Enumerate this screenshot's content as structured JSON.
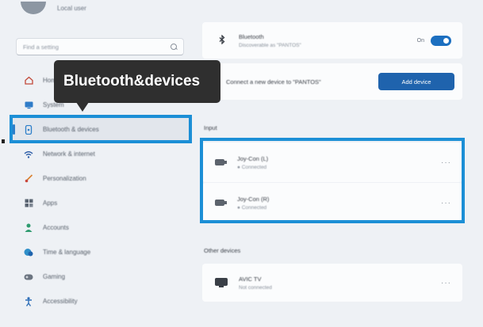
{
  "user": {
    "name": "Local user"
  },
  "search": {
    "placeholder": "Find a setting"
  },
  "sidebar": {
    "items": [
      {
        "label": "Home",
        "icon": "home-icon"
      },
      {
        "label": "System",
        "icon": "monitor-icon"
      },
      {
        "label": "Bluetooth & devices",
        "icon": "bluetooth-devices-icon",
        "selected": true
      },
      {
        "label": "Network & internet",
        "icon": "wifi-icon"
      },
      {
        "label": "Personalization",
        "icon": "brush-icon"
      },
      {
        "label": "Apps",
        "icon": "apps-icon"
      },
      {
        "label": "Accounts",
        "icon": "person-icon"
      },
      {
        "label": "Time & language",
        "icon": "globe-clock-icon"
      },
      {
        "label": "Gaming",
        "icon": "gamepad-icon"
      },
      {
        "label": "Accessibility",
        "icon": "accessibility-icon"
      }
    ]
  },
  "tooltip": {
    "label": "Bluetooth&devices"
  },
  "bluetooth": {
    "title": "Bluetooth",
    "subtitle": "Discoverable as \"PANTOS\"",
    "toggle_state": "On",
    "toggle_on": true
  },
  "add_device": {
    "text": "Connect a new device to \"PANTOS\"",
    "button_label": "Add device"
  },
  "sections": {
    "input": "Input",
    "other": "Other devices"
  },
  "input_devices": [
    {
      "name": "Joy-Con (L)",
      "status": "● Connected",
      "icon": "controller-icon"
    },
    {
      "name": "Joy-Con (R)",
      "status": "● Connected",
      "icon": "controller-icon"
    }
  ],
  "other_devices": [
    {
      "name": "AVIC TV",
      "status": "Not connected",
      "icon": "tv-icon"
    }
  ],
  "colors": {
    "accent": "#1f63ad",
    "highlight": "#1c8fd6",
    "tooltip_bg": "#2f2f2f"
  }
}
